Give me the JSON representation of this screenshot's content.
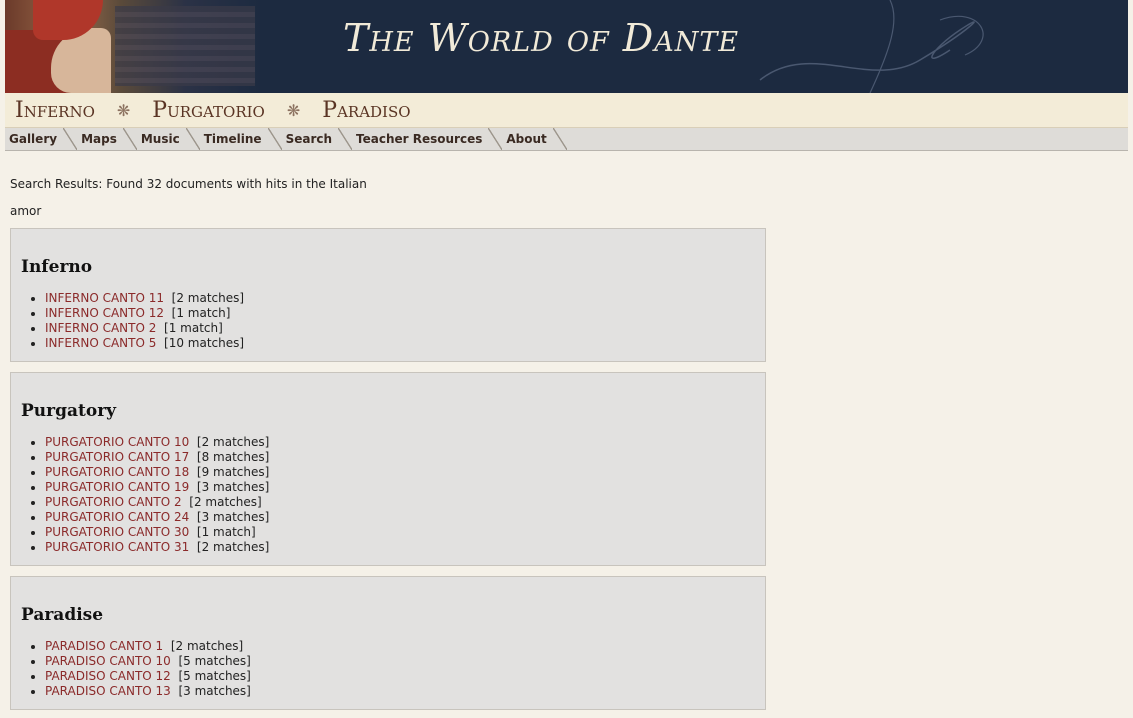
{
  "site": {
    "title": "The World of Dante"
  },
  "canticles": [
    "Inferno",
    "Purgatorio",
    "Paradiso"
  ],
  "canticle_separator": "❋",
  "nav": [
    "Gallery",
    "Maps",
    "Music",
    "Timeline",
    "Search",
    "Teacher Resources",
    "About"
  ],
  "results": {
    "summary": "Search Results: Found 32 documents with hits in the Italian",
    "query": "amor"
  },
  "sections": [
    {
      "heading": "Inferno",
      "items": [
        {
          "link": "INFERNO CANTO 11",
          "count": "[2 matches]"
        },
        {
          "link": "INFERNO CANTO 12",
          "count": "[1 match]"
        },
        {
          "link": "INFERNO CANTO 2",
          "count": "[1 match]"
        },
        {
          "link": "INFERNO CANTO 5",
          "count": "[10 matches]"
        }
      ]
    },
    {
      "heading": "Purgatory",
      "items": [
        {
          "link": "PURGATORIO CANTO 10",
          "count": "[2 matches]"
        },
        {
          "link": "PURGATORIO CANTO 17",
          "count": "[8 matches]"
        },
        {
          "link": "PURGATORIO CANTO 18",
          "count": "[9 matches]"
        },
        {
          "link": "PURGATORIO CANTO 19",
          "count": "[3 matches]"
        },
        {
          "link": "PURGATORIO CANTO 2",
          "count": "[2 matches]"
        },
        {
          "link": "PURGATORIO CANTO 24",
          "count": "[3 matches]"
        },
        {
          "link": "PURGATORIO CANTO 30",
          "count": "[1 match]"
        },
        {
          "link": "PURGATORIO CANTO 31",
          "count": "[2 matches]"
        }
      ]
    },
    {
      "heading": "Paradise",
      "items": [
        {
          "link": "PARADISO CANTO 1",
          "count": "[2 matches]"
        },
        {
          "link": "PARADISO CANTO 10",
          "count": "[5 matches]"
        },
        {
          "link": "PARADISO CANTO 12",
          "count": "[5 matches]"
        },
        {
          "link": "PARADISO CANTO 13",
          "count": "[3 matches]"
        }
      ]
    }
  ],
  "colors": {
    "banner": "#1c2a40",
    "link": "#8b2a2a",
    "page_bg": "#f5f1e8",
    "section_bg": "#e2e1e0"
  }
}
